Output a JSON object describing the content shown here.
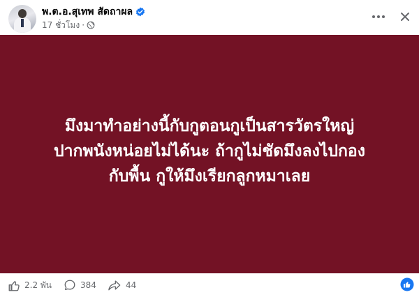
{
  "header": {
    "author_name": "พ.ต.อ.สุเทพ สัดถาผล",
    "time_ago": "17 ชั่วโมง",
    "separator": "·",
    "audience_icon": "globe-icon",
    "verified_icon": "verified-badge-icon",
    "more_icon": "more-options-icon",
    "close_icon": "close-icon"
  },
  "post": {
    "background_color": "#731225",
    "text_color": "#ffffff",
    "lines": [
      "มึงมาทำอย่างนี้กับกูตอนกูเป็นสารวัตรใหญ่",
      "ปากพนังหน่อยไม่ได้นะ ถ้ากูไม่ชัดมึงลงไปกอง",
      "กับพื้น กูให้มึงเรียกลูกหมาเลย"
    ]
  },
  "footer": {
    "likes": "2.2 พัน",
    "comments": "384",
    "shares": "44",
    "like_icon": "like-icon",
    "comment_icon": "comment-icon",
    "share_icon": "share-icon",
    "reaction_badge_icon": "like-reaction-badge-icon",
    "accent_color": "#1877f2"
  }
}
